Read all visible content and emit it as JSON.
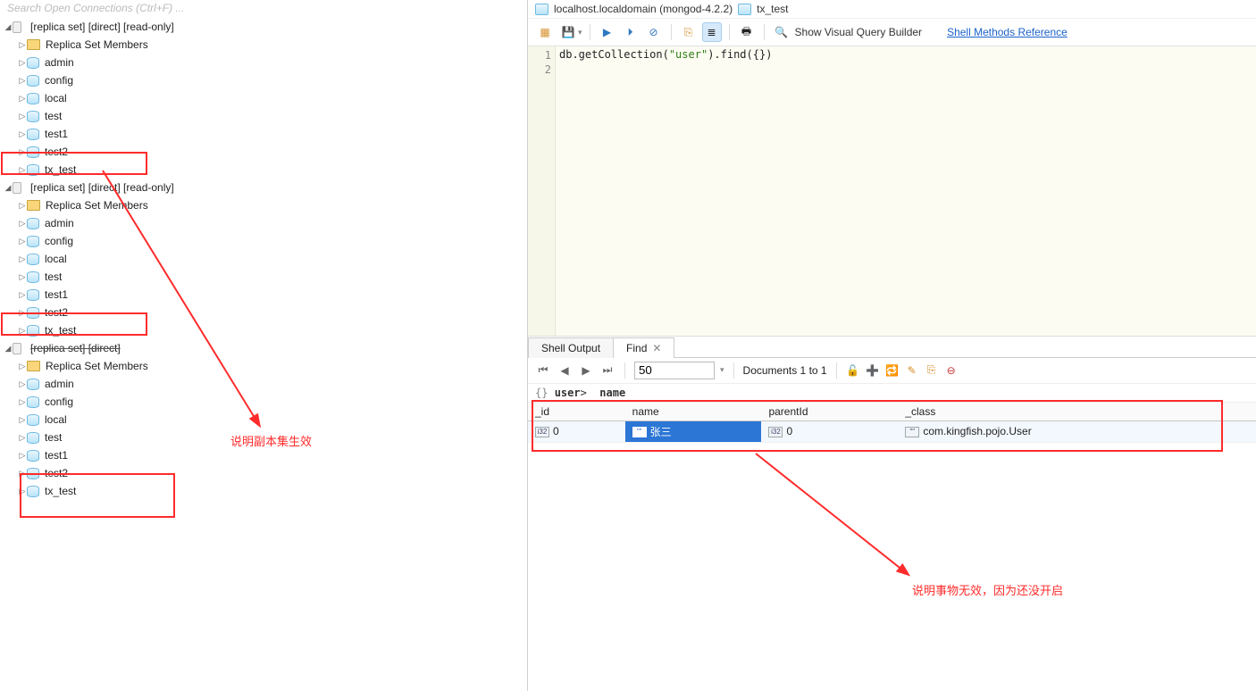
{
  "left": {
    "search_placeholder": "Search Open Connections (Ctrl+F) ...",
    "conn_label": "[replica set] [direct] [read-only]",
    "conn_label3": "[replica set] [direct]",
    "members": "Replica Set Members",
    "dbs": [
      "admin",
      "config",
      "local",
      "test",
      "test1",
      "test2",
      "tx_test"
    ],
    "annotation": "说明副本集生效"
  },
  "right": {
    "crumb_host": "localhost.localdomain (mongod-4.2.2)",
    "crumb_db": "tx_test",
    "vq_label": "Show Visual Query Builder",
    "shell_ref": "Shell Methods Reference",
    "code_line": "db.getCollection(\"user\").find({})",
    "tabs": {
      "shell": "Shell Output",
      "find": "Find"
    },
    "page_size": "50",
    "docs_label": "Documents 1 to 1",
    "path": "user> name",
    "columns": [
      "_id",
      "name",
      "parentId",
      "_class"
    ],
    "row": {
      "_id": "0",
      "name": "张三",
      "parentId": "0",
      "_class": "com.kingfish.pojo.User"
    },
    "annotation": "说明事物无效，因为还没开启"
  }
}
